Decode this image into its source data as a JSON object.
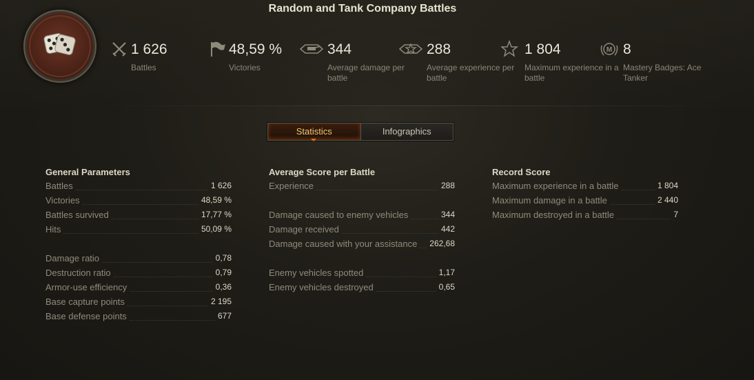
{
  "page_title": "Random and Tank Company Battles",
  "header_stats": [
    {
      "icon": "crossed-swords-icon",
      "value": "1 626",
      "label": "Battles"
    },
    {
      "icon": "flag-icon",
      "value": "48,59 %",
      "label": "Victories"
    },
    {
      "icon": "damage-tank-icon",
      "value": "344",
      "label": "Average damage per battle"
    },
    {
      "icon": "winged-star-icon",
      "value": "288",
      "label": "Average experience per battle"
    },
    {
      "icon": "star-icon",
      "value": "1 804",
      "label": "Maximum experience in a battle"
    },
    {
      "icon": "mastery-badge-icon",
      "value": "8",
      "label": "Mastery Badges: Ace Tanker"
    }
  ],
  "tabs": {
    "statistics": "Statistics",
    "infographics": "Infographics"
  },
  "general": {
    "title": "General Parameters",
    "rows": [
      {
        "label": "Battles",
        "value": "1 626"
      },
      {
        "label": "Victories",
        "value": "48,59 %"
      },
      {
        "label": "Battles survived",
        "value": "17,77 %"
      },
      {
        "label": "Hits",
        "value": "50,09 %"
      },
      {
        "label": "Damage ratio",
        "value": "0,78"
      },
      {
        "label": "Destruction ratio",
        "value": "0,79"
      },
      {
        "label": "Armor-use efficiency",
        "value": "0,36"
      },
      {
        "label": "Base capture points",
        "value": "2 195"
      },
      {
        "label": "Base defense points",
        "value": "677"
      }
    ]
  },
  "average": {
    "title": "Average Score per Battle",
    "rows": [
      {
        "label": "Experience",
        "value": "288"
      },
      {
        "label": "Damage caused to enemy vehicles",
        "value": "344"
      },
      {
        "label": "Damage received",
        "value": "442"
      },
      {
        "label": "Damage caused with your assistance",
        "value": "262,68"
      },
      {
        "label": "Enemy vehicles spotted",
        "value": "1,17"
      },
      {
        "label": "Enemy vehicles destroyed",
        "value": "0,65"
      }
    ]
  },
  "record": {
    "title": "Record Score",
    "rows": [
      {
        "label": "Maximum experience in a battle",
        "value": "1 804"
      },
      {
        "label": "Maximum damage in a battle",
        "value": "2 440"
      },
      {
        "label": "Maximum destroyed in a battle",
        "value": "7"
      }
    ]
  }
}
